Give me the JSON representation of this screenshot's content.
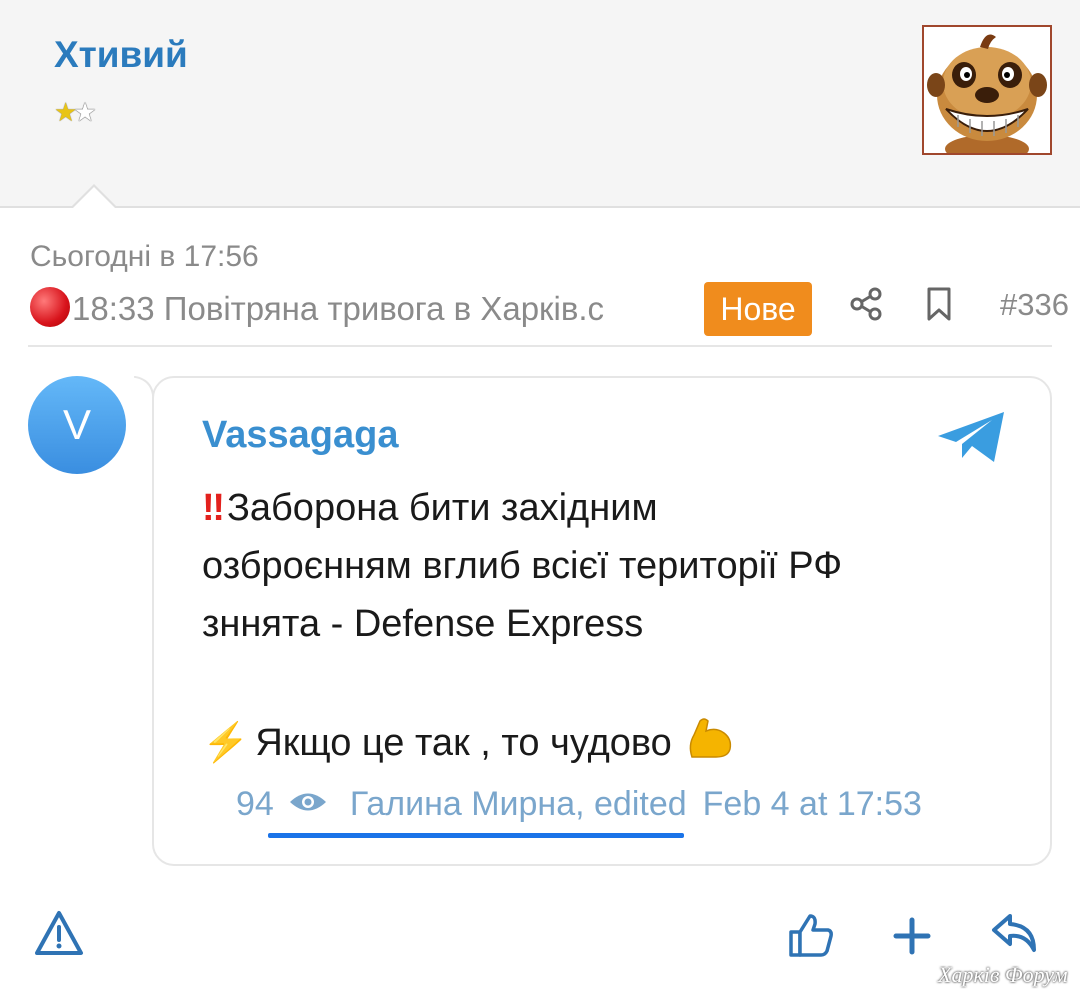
{
  "user": {
    "name": "Хтивий",
    "stars": [
      "★",
      "★"
    ]
  },
  "post": {
    "date": "Сьогодні в 17:56",
    "thread_title": "18:33 Повітряна тривога в Харків.с",
    "badge": "Нове",
    "post_number": "#336"
  },
  "telegram": {
    "avatar_letter": "V",
    "channel": "Vassagaga",
    "bang": "‼",
    "lines": [
      "Заборона бити західним",
      "озброєнням вглиб всієї території РФ",
      "зннята - Defense Express"
    ],
    "bolt": "⚡",
    "line4": "Якщо це так , то чудово",
    "views": "94",
    "author": "Галина Мирна, edited",
    "timestamp": "Feb 4 at 17:53"
  },
  "watermark": "Харків Форум",
  "colors": {
    "accent": "#2b7bbd",
    "badge": "#f08c1d",
    "telegram": "#3a8fd0",
    "underline": "#1a73e8"
  }
}
